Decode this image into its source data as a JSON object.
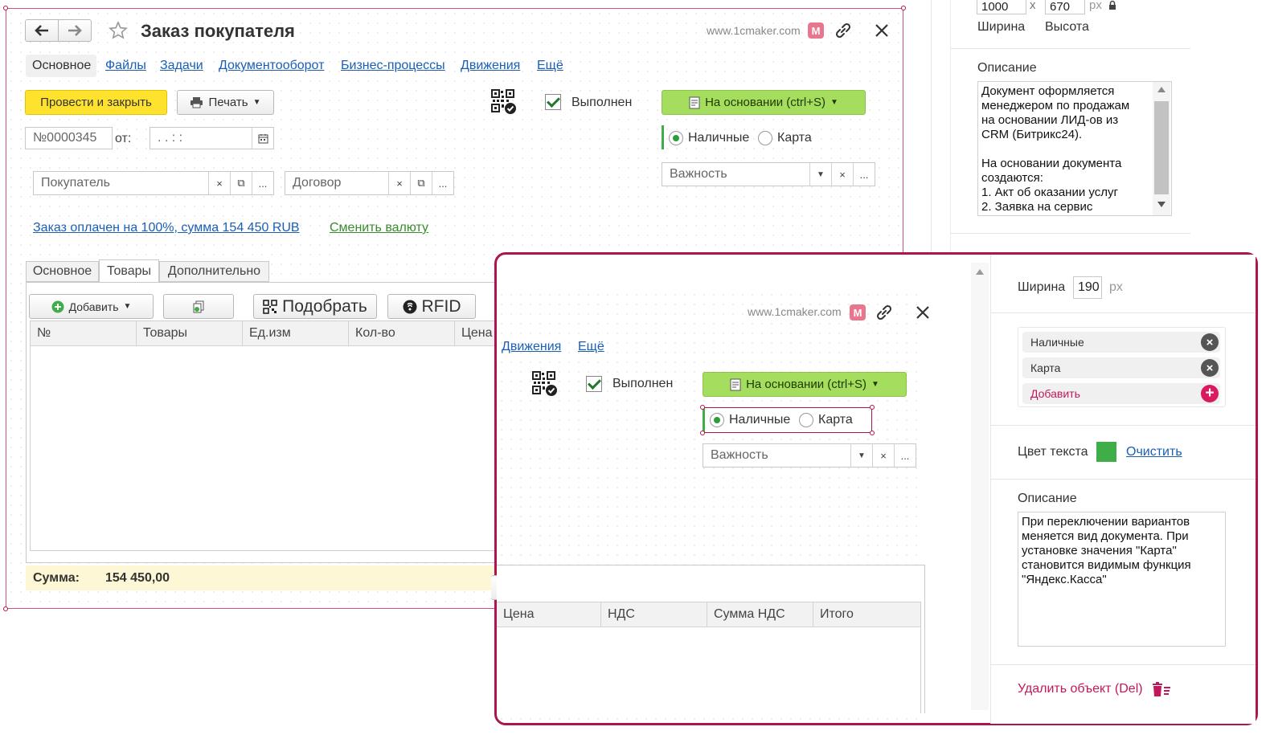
{
  "main_form": {
    "title": "Заказ покупателя",
    "site": "www.1cmaker.com",
    "brand_badge": "M",
    "tabs": [
      "Основное",
      "Файлы",
      "Задачи",
      "Документооборот",
      "Бизнес-процессы",
      "Движения",
      "Ещё"
    ],
    "post_close_button": "Провести и закрыть",
    "print_button": "Печать",
    "done_label": "Выполнен",
    "based_on_button": "На основании (ctrl+S)",
    "number_value": "№0000345",
    "date_from_label": "от:",
    "date_value": ". . : :",
    "payment_cash": "Наличные",
    "payment_card": "Карта",
    "buyer_placeholder": "Покупатель",
    "contract_placeholder": "Договор",
    "importance_placeholder": "Важность",
    "clear_symbol": "×",
    "copy_symbol": "⧉",
    "more_symbol": "...",
    "paid_link": "Заказ оплачен на 100%, сумма 154 450 RUB",
    "change_currency_link": "Сменить валюту",
    "sub_tabs": [
      "Основное",
      "Товары",
      "Дополнительно"
    ],
    "add_button": "Добавить",
    "pick_button": "Подобрать",
    "rfid_button": "RFID",
    "table_headers": [
      "№",
      "Товары",
      "Ед.изм",
      "Кол-во",
      "Цена"
    ],
    "sum_label": "Сумма:",
    "sum_value": "154 450,00"
  },
  "top_props": {
    "width_value": "1000",
    "times_sign": "x",
    "height_value": "670",
    "px_unit": "px",
    "width_label": "Ширина",
    "height_label": "Высота",
    "description_label": "Описание",
    "description_text": "Документ оформляется\nменеджером по продажам\nна основании ЛИД-ов из\nCRM (Битрикс24).\n\nНа основании документа\nсоздаются:\n1. Акт об оказании услуг\n2. Заявка на сервис"
  },
  "zoom_form": {
    "site": "www.1cmaker.com",
    "brand_badge": "M",
    "tab_movements": "Движения",
    "tab_more": "Ещё",
    "done_label": "Выполнен",
    "based_on_button": "На основании (ctrl+S)",
    "payment_cash": "Наличные",
    "payment_card": "Карта",
    "importance_placeholder": "Важность",
    "clear_symbol": "×",
    "more_symbol": "...",
    "table_headers": [
      "Цена",
      "НДС",
      "Сумма НДС",
      "Итого"
    ]
  },
  "zoom_props": {
    "width_label": "Ширина",
    "width_value": "190",
    "px_unit": "px",
    "options": [
      "Наличные",
      "Карта"
    ],
    "add_option": "Добавить",
    "text_color_label": "Цвет текста",
    "text_color": "#3fae49",
    "clear_link": "Очистить",
    "description_label": "Описание",
    "description_text": "При переключении вариантов\nменяется вид документа. При\nустановке значения \"Карта\"\nстановится видимым функция\n\"Яндекс.Касса\"",
    "delete_label": "Удалить объект (Del)"
  },
  "colors": {
    "accent_border": "#b0144f",
    "link": "#1a5fb4",
    "post_button": "#ffe22e",
    "based_on_button": "#a5dd5e",
    "sum_bar": "#fdf7d5",
    "delete": "#c2185b"
  },
  "icons": [
    "arrow-left-icon",
    "arrow-right-icon",
    "star-icon",
    "link-icon",
    "close-icon",
    "printer-icon",
    "qr-code-icon",
    "document-icon",
    "calendar-icon",
    "plus-circle-icon",
    "rfid-icon",
    "trash-icon",
    "lock-icon",
    "scroll-up-icon",
    "scroll-down-icon"
  ]
}
